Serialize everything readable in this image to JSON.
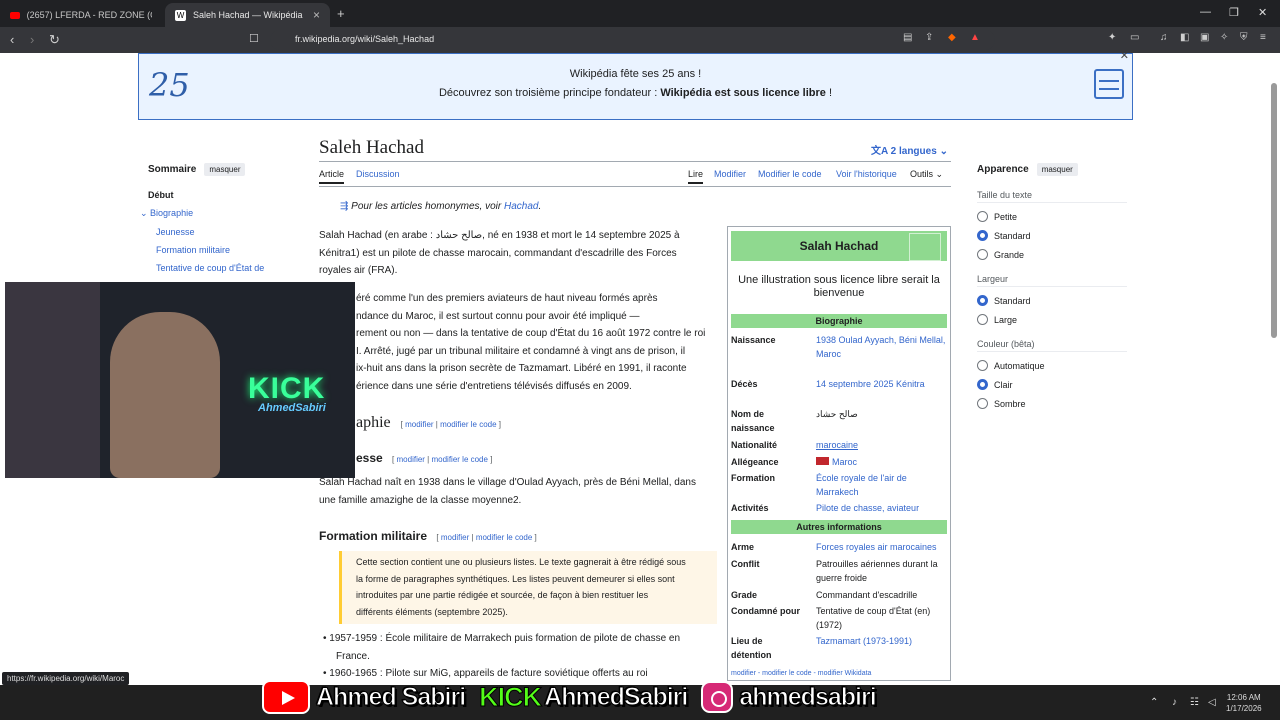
{
  "browser": {
    "tabs": [
      {
        "label": "(2657) LFERDA - RED ZONE (Official ...",
        "icon": "youtube-icon"
      },
      {
        "label": "Saleh Hachad — Wikipédia",
        "icon": "wikipedia-icon"
      }
    ],
    "new_tab": "+",
    "url": "fr.wikipedia.org/wiki/Saleh_Hachad",
    "status_link": "https://fr.wikipedia.org/wiki/Maroc"
  },
  "banner": {
    "logo": "25",
    "line1": "Wikipédia fête ses 25 ans !",
    "line2_prefix": "Découvrez son troisième principe fondateur : ",
    "line2_bold": "Wikipédia est sous licence libre",
    "line2_suffix": " !"
  },
  "toc": {
    "title": "Sommaire",
    "hide": "masquer",
    "items": [
      "Début",
      "Biographie",
      "Jeunesse",
      "Formation militaire",
      "Tentative de coup d'État de"
    ]
  },
  "article": {
    "title": "Saleh Hachad",
    "langs": "2 langues",
    "tabs": [
      "Article",
      "Discussion",
      "Lire",
      "Modifier",
      "Modifier le code",
      "Voir l'historique",
      "Outils"
    ],
    "hatnote_prefix": "Pour les articles homonymes, voir ",
    "hatnote_link": "Hachad",
    "hatnote_suffix": ".",
    "intro_lines": [
      "Salah Hachad (en arabe : صالح حشاد, né en 1938 et mort le 14 septembre 2025 à",
      "Kénitra1) est un pilote de chasse marocain, commandant d'escadrille des Forces",
      "royales air (FRA)."
    ],
    "para2_lines": [
      "éré comme l'un des premiers aviateurs de haut niveau formés après",
      "ndance du Maroc, il est surtout connu pour avoir été impliqué —",
      "rement ou non — dans la tentative de coup d'État du 16 août 1972 contre le roi",
      "I. Arrêté, jugé par un tribunal militaire et condamné à vingt ans de prison, il",
      "ix-huit ans dans la prison secrète de Tazmamart. Libéré en 1991, il raconte",
      "érience dans une série d'entretiens télévisés diffusés en 2009."
    ],
    "h2_bio": "aphie",
    "h3_jeunesse": "esse",
    "edit_link": "modifier",
    "edit_code_link": "modifier le code",
    "jeunesse_lines": [
      "Salah Hachad naît en 1938 dans le village d'Oulad Ayyach, près de Béni Mellal, dans",
      "une famille amazighe de la classe moyenne2."
    ],
    "h3_formation": "Formation militaire",
    "ambox_lines": [
      "Cette section contient une ou plusieurs listes. Le texte gagnerait à être rédigé sous",
      "la forme de paragraphes synthétiques. Les listes peuvent demeurer si elles sont",
      "introduites par une partie rédigée et sourcée, de façon à bien restituer les",
      "différents éléments  (septembre 2025)."
    ],
    "list": [
      "1957-1959 : École militaire de Marrakech puis formation de pilote de chasse en",
      "France.",
      "1960-1965 : Pilote sur MiG, appareils de facture soviétique offerts au roi"
    ]
  },
  "infobox": {
    "title": "Salah Hachad",
    "no_image": "Une illustration sous licence libre serait la bienvenue",
    "section_bio": "Biographie",
    "section_other": "Autres informations",
    "rows_bio": [
      {
        "k": "Naissance",
        "v": "1938 Oulad Ayyach, Béni Mellal, Maroc"
      },
      {
        "k": "Décès",
        "v": "14 septembre 2025 Kénitra"
      },
      {
        "k": "Nom de naissance",
        "v": "صالح حشاد"
      },
      {
        "k": "Nationalité",
        "v": "marocaine"
      },
      {
        "k": "Allégeance",
        "v": "Maroc"
      },
      {
        "k": "Formation",
        "v": "École royale de l'air de Marrakech"
      },
      {
        "k": "Activités",
        "v": "Pilote de chasse, aviateur"
      }
    ],
    "rows_other": [
      {
        "k": "Arme",
        "v": "Forces royales air marocaines"
      },
      {
        "k": "Conflit",
        "v": "Patrouilles aériennes durant la guerre froide"
      },
      {
        "k": "Grade",
        "v": "Commandant d'escadrille"
      },
      {
        "k": "Condamné pour",
        "v": "Tentative de coup d'État (en) (1972)"
      },
      {
        "k": "Lieu de détention",
        "v": "Tazmamart (1973-1991)"
      }
    ],
    "footer": "modifier - modifier le code - modifier Wikidata"
  },
  "appearance": {
    "title": "Apparence",
    "hide": "masquer",
    "text_size_label": "Taille du texte",
    "text_sizes": [
      "Petite",
      "Standard",
      "Grande"
    ],
    "width_label": "Largeur",
    "widths": [
      "Standard",
      "Large"
    ],
    "color_label": "Couleur (bêta)",
    "colors": [
      "Automatique",
      "Clair",
      "Sombre"
    ]
  },
  "overlay": {
    "cam_kick": "KICK",
    "cam_name": "AhmedSabiri",
    "youtube": "Ahmed Sabiri",
    "kick_logo": "KICK",
    "kick_name": "AhmedSabiri",
    "instagram": "ahmedsabiri"
  },
  "system": {
    "time": "12:06 AM",
    "date": "1/17/2026"
  },
  "colors": {
    "link": "#3366cc",
    "infobox_header": "#8fd98f",
    "banner_bg": "#eaf3ff"
  }
}
